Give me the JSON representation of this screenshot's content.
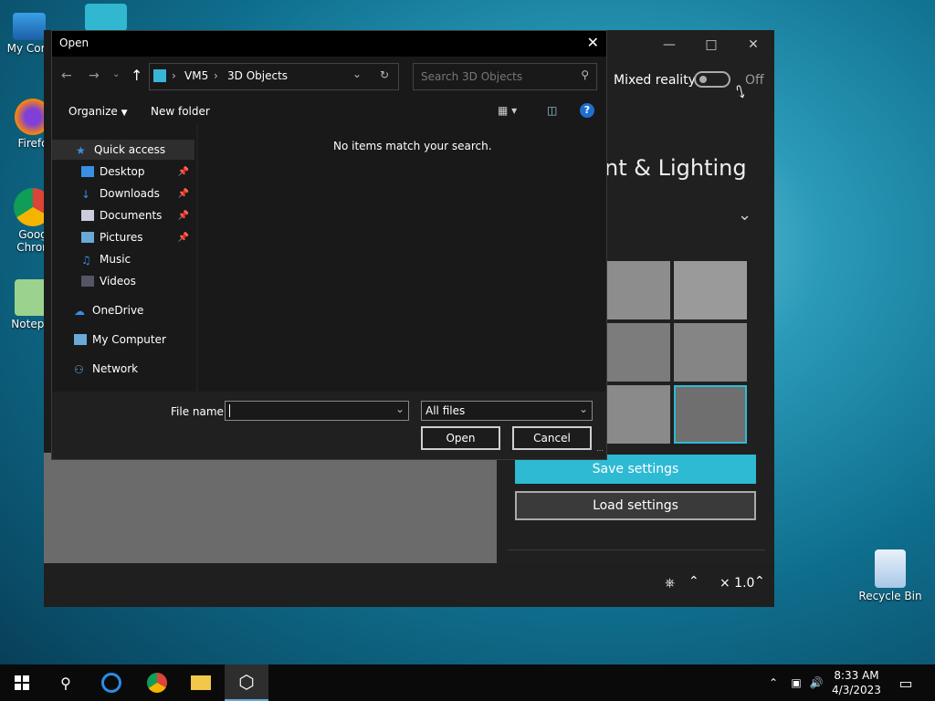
{
  "desktop": {
    "icons": [
      {
        "label": "My Com",
        "name": "my-computer"
      },
      {
        "label": "Firefo",
        "name": "firefox"
      },
      {
        "label": "Goog Chron",
        "name": "google-chrome"
      },
      {
        "label": "Notepa",
        "name": "notepad"
      },
      {
        "label": "Recycle Bin",
        "name": "recycle-bin"
      }
    ]
  },
  "viewer": {
    "mixed_reality_label": "Mixed reality",
    "toggle_state": "Off",
    "section_title": "nt & Lighting",
    "save_button": "Save settings",
    "load_button": "Load settings",
    "zoom": "× 1.0"
  },
  "dialog": {
    "title": "Open",
    "breadcrumb": [
      "VM5",
      "3D Objects"
    ],
    "search_placeholder": "Search 3D Objects",
    "organize": "Organize",
    "new_folder": "New folder",
    "empty_message": "No items match your search.",
    "nav": {
      "quick_access": "Quick access",
      "items": [
        "Desktop",
        "Downloads",
        "Documents",
        "Pictures",
        "Music",
        "Videos"
      ],
      "onedrive": "OneDrive",
      "my_computer": "My Computer",
      "network": "Network"
    },
    "file_name_label": "File name:",
    "file_name_value": "",
    "file_type": "All files",
    "open_button": "Open",
    "cancel_button": "Cancel"
  },
  "taskbar": {
    "time": "8:33 AM",
    "date": "4/3/2023"
  }
}
